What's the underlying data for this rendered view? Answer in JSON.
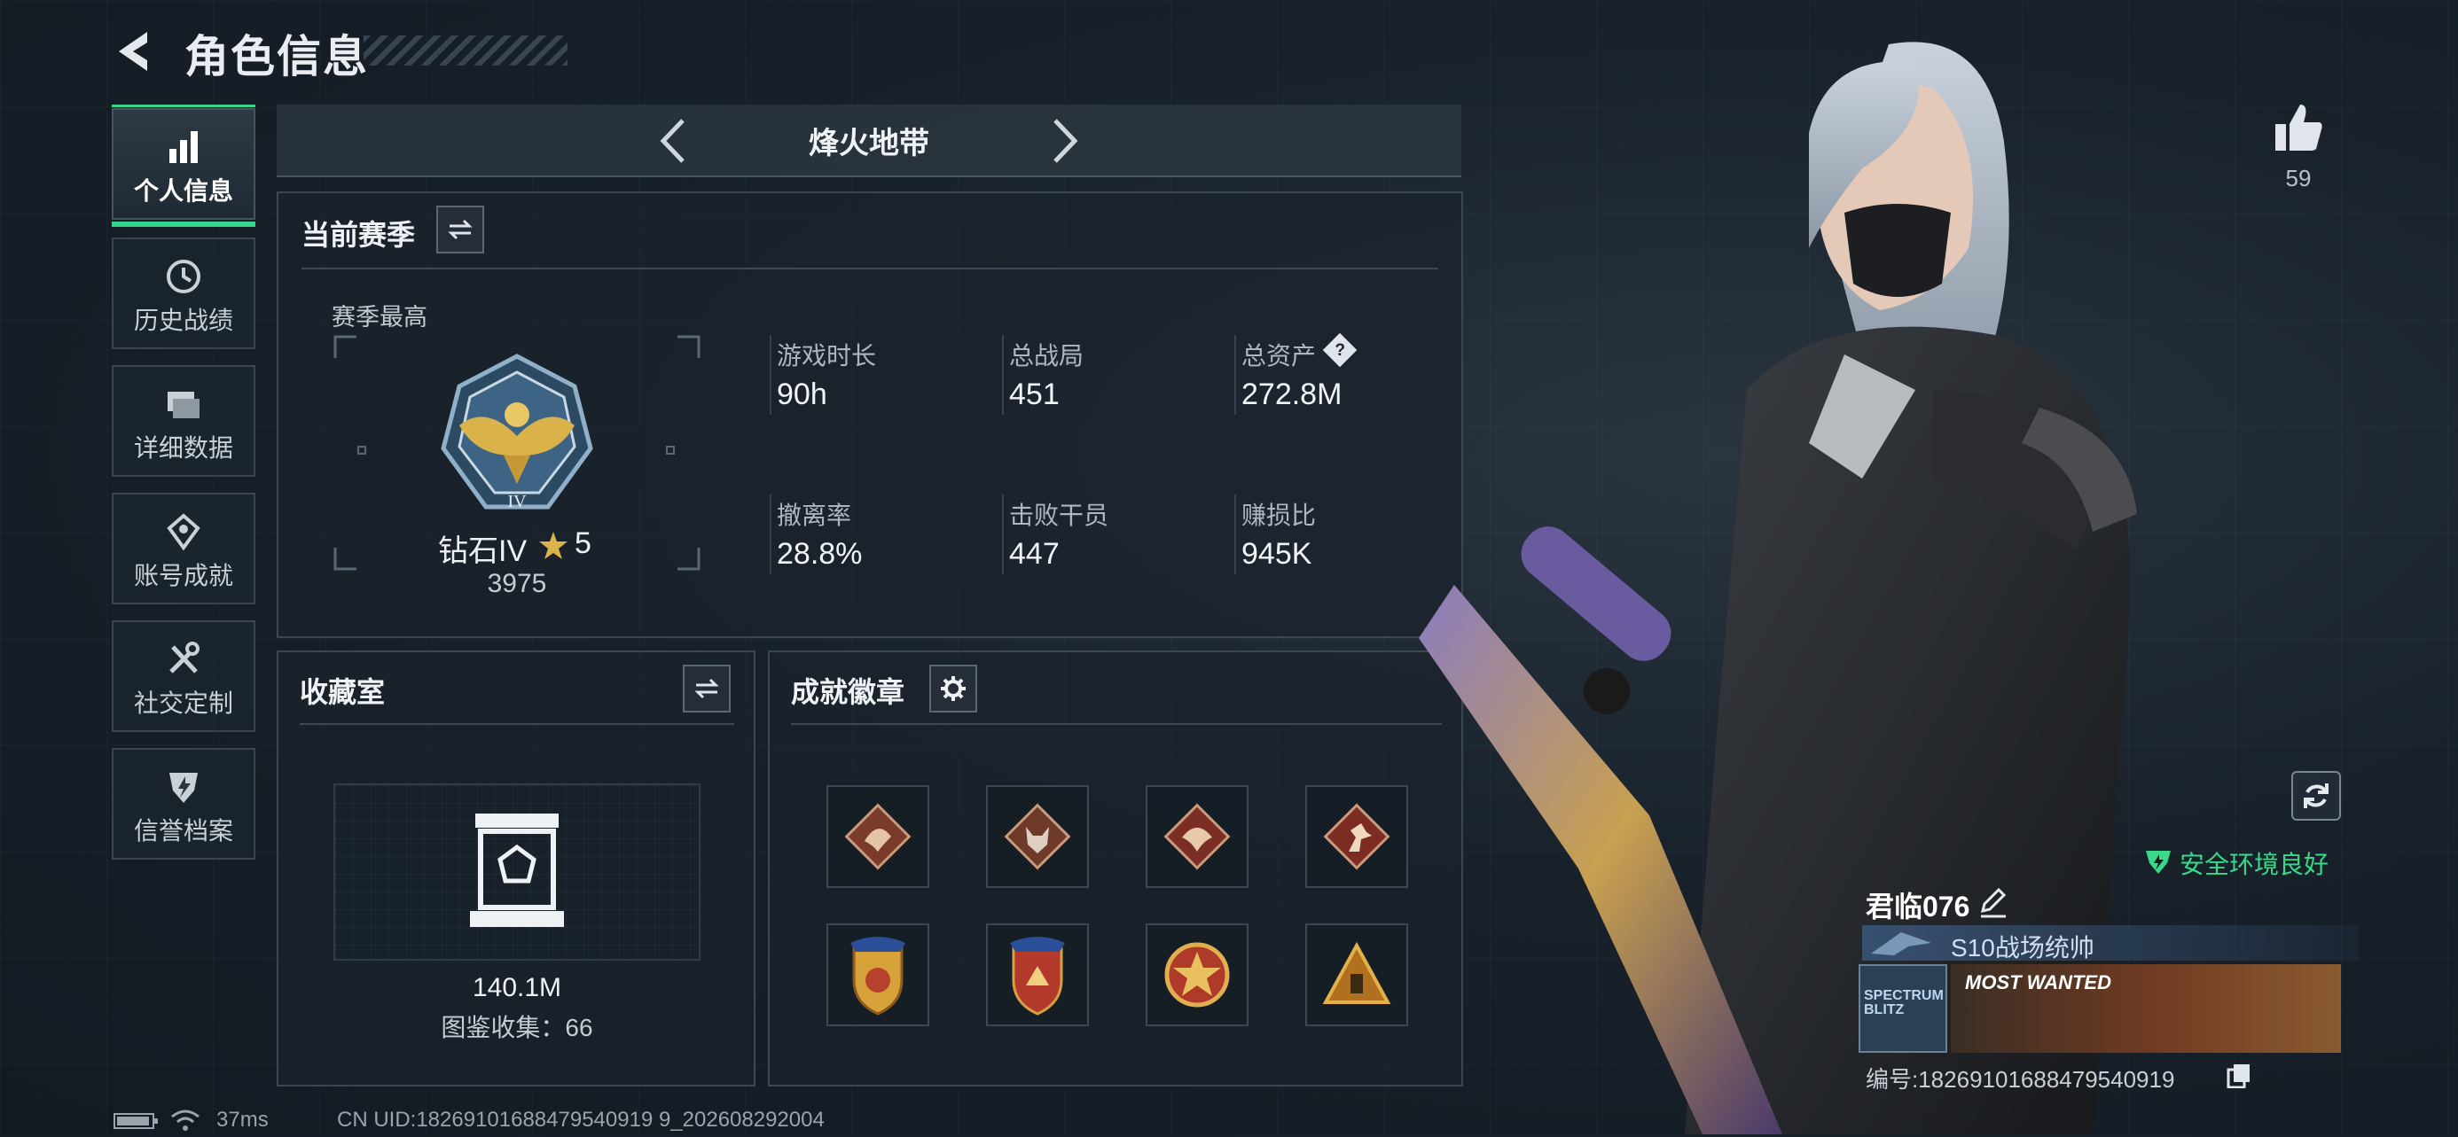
{
  "header": {
    "title": "角色信息"
  },
  "nav": [
    {
      "label": "个人信息",
      "icon": "bar-chart-icon",
      "active": true
    },
    {
      "label": "历史战绩",
      "icon": "history-icon",
      "active": false
    },
    {
      "label": "详细数据",
      "icon": "folder-icon",
      "active": false
    },
    {
      "label": "账号成就",
      "icon": "achievement-icon",
      "active": false
    },
    {
      "label": "社交定制",
      "icon": "tools-icon",
      "active": false
    },
    {
      "label": "信誉档案",
      "icon": "shield-icon",
      "active": false
    }
  ],
  "map": {
    "name": "烽火地带"
  },
  "season": {
    "title": "当前赛季",
    "best_label": "赛季最高",
    "rank_name": "钻石IV",
    "rank_stars": "5",
    "rank_points": "3975",
    "stats": [
      {
        "label": "游戏时长",
        "value": "90h"
      },
      {
        "label": "总战局",
        "value": "451"
      },
      {
        "label": "总资产",
        "value": "272.8M"
      },
      {
        "label": "撤离率",
        "value": "28.8%"
      },
      {
        "label": "击败干员",
        "value": "447"
      },
      {
        "label": "赚损比",
        "value": "945K"
      }
    ],
    "help_mark": "?"
  },
  "collection": {
    "title": "收藏室",
    "value": "140.1M",
    "count_label": "图鉴收集：66"
  },
  "badges": {
    "title": "成就徽章",
    "items": [
      "dragon-badge-icon",
      "wolf-badge-icon",
      "dragon-red-badge-icon",
      "runner-badge-icon",
      "shield-blue-badge-icon",
      "shield-red-badge-icon",
      "star-medal-badge-icon",
      "pyramid-badge-icon"
    ]
  },
  "profile": {
    "likes": "59",
    "safe_status": "安全环境良好",
    "player_name": "君临076",
    "title": "S10战场统帅",
    "card1_text": "SPECTRUM BLITZ",
    "card2_text": "MOST WANTED",
    "serial": "编号:18269101688479540919"
  },
  "statusbar": {
    "ping": "37ms",
    "uid": "CN UID:18269101688479540919 9_202608292004"
  },
  "colors": {
    "accent": "#37d58c",
    "safe": "#39d98a",
    "gold": "#d9b34a"
  }
}
